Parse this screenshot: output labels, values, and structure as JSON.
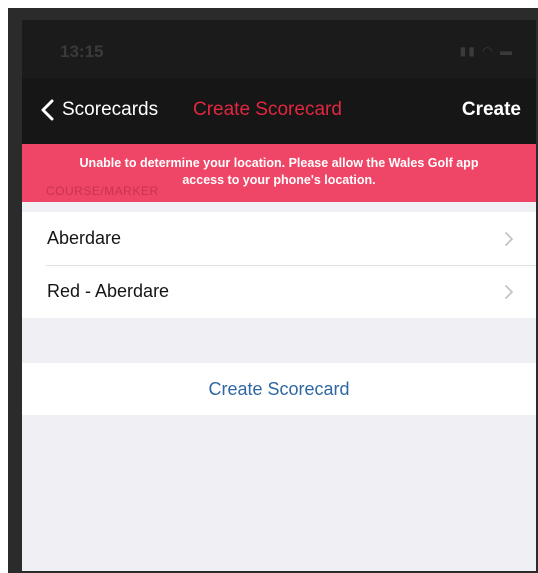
{
  "status_bar": {
    "time": "13:15",
    "icons": [
      "signal-icon",
      "wifi-icon",
      "battery-icon"
    ]
  },
  "nav": {
    "back_label": "Scorecards",
    "title": "Create Scorecard",
    "create_label": "Create"
  },
  "banner": {
    "message_line1": "Unable to determine your location. Please allow the Wales Golf app",
    "message_line2": "access to your phone's location.",
    "hidden_header": "COURSE/MARKER"
  },
  "courses": [
    {
      "label": "Aberdare"
    },
    {
      "label": "Red - Aberdare"
    }
  ],
  "action": {
    "label": "Create Scorecard"
  },
  "colors": {
    "nav_background": "#161616",
    "title_red": "#e0273f",
    "banner_background": "#ef4566",
    "link_blue": "#2f67a3",
    "page_background": "#efeff4"
  }
}
